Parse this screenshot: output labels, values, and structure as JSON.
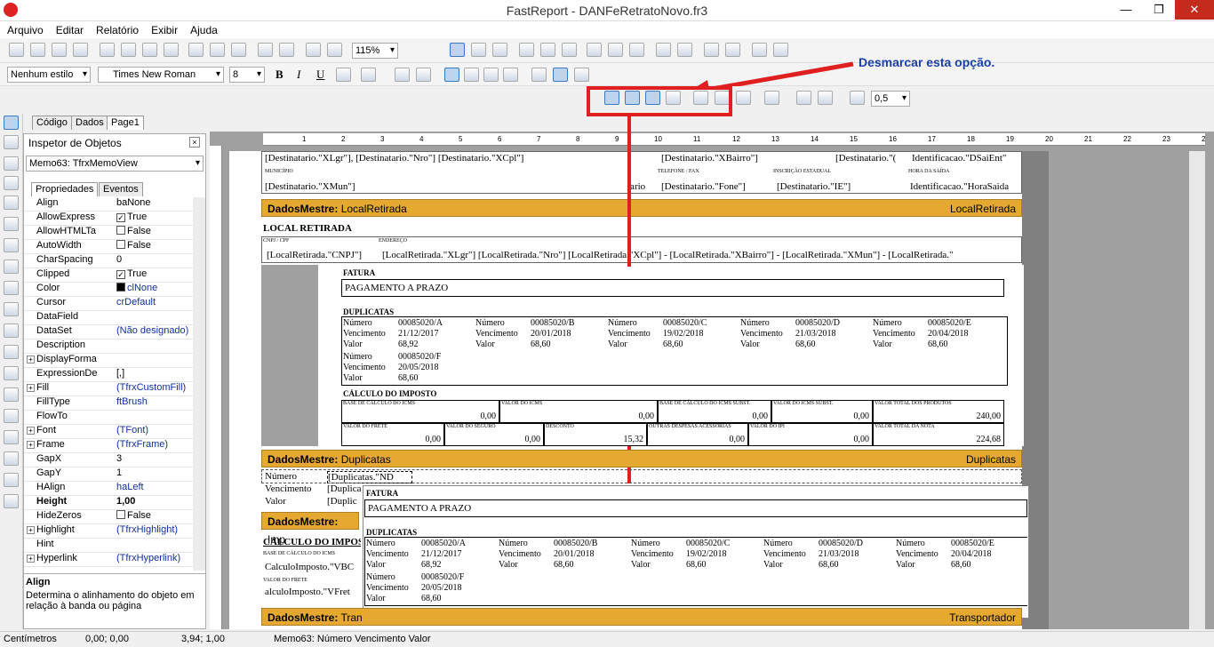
{
  "window": {
    "title": "FastReport - DANFeRetratoNovo.fr3",
    "min": "—",
    "max": "❐",
    "close": "✕"
  },
  "menu": [
    "Arquivo",
    "Editar",
    "Relatório",
    "Exibir",
    "Ajuda"
  ],
  "toolbar": {
    "zoom": "115%",
    "style": "Nenhum estilo",
    "font": "Times New Roman",
    "size": "8",
    "frame_width": "0,5"
  },
  "annotation": "Desmarcar esta opção.",
  "tabs": [
    "Código",
    "Dados",
    "Page1"
  ],
  "inspector": {
    "title": "Inspetor de Objetos",
    "object": "Memo63: TfrxMemoView",
    "tab_props": "Propriedades",
    "tab_events": "Eventos",
    "rows": [
      [
        "Align",
        "baNone"
      ],
      [
        "AllowExpress",
        "True"
      ],
      [
        "AllowHTMLTa",
        "False"
      ],
      [
        "AutoWidth",
        "False"
      ],
      [
        "CharSpacing",
        "0"
      ],
      [
        "Clipped",
        "True"
      ],
      [
        "Color",
        "clNone"
      ],
      [
        "Cursor",
        "crDefault"
      ],
      [
        "DataField",
        ""
      ],
      [
        "DataSet",
        "(Não designado)"
      ],
      [
        "Description",
        ""
      ],
      [
        "DisplayForma",
        ""
      ],
      [
        "ExpressionDe",
        "[,]"
      ],
      [
        "Fill",
        "(TfrxCustomFill)"
      ],
      [
        "FillType",
        "ftBrush"
      ],
      [
        "FlowTo",
        ""
      ],
      [
        "Font",
        "(TFont)"
      ],
      [
        "Frame",
        "(TfrxFrame)"
      ],
      [
        "GapX",
        "3"
      ],
      [
        "GapY",
        "1"
      ],
      [
        "HAlign",
        "haLeft"
      ],
      [
        "Height",
        "1,00"
      ],
      [
        "HideZeros",
        "False"
      ],
      [
        "Highlight",
        "(TfrxHighlight)"
      ],
      [
        "Hint",
        ""
      ],
      [
        "Hyperlink",
        "(TfrxHyperlink)"
      ]
    ],
    "help_title": "Align",
    "help_text": "Determina o alinhamento do objeto em relação à banda ou página"
  },
  "ruler": [
    "1",
    "2",
    "3",
    "4",
    "5",
    "6",
    "7",
    "8",
    "9",
    "10",
    "11",
    "12",
    "13",
    "14",
    "15",
    "16",
    "17",
    "18",
    "19",
    "20",
    "21",
    "22",
    "23",
    "24"
  ],
  "report": {
    "dest1": "[Destinatario.\"XLgr\"], [Destinatario.\"Nro\"]  [Destinatario.\"XCpl\"]",
    "dest2": "[Destinatario.\"XBairro\"]",
    "dest3": "[Destinatario.\"(",
    "dest4": "Identificacao.\"DSaiEnt\"",
    "lbl_mun": "MUNICÍPIO",
    "lbl_tel": "TELEFONE / FAX",
    "lbl_ie": "INSCRIÇÃO ESTADUAL",
    "lbl_hora": "HORA DA SAÍDA",
    "mun": "[Destinatario.\"XMun\"]",
    "uf": "tario",
    "fone": "[Destinatario.\"Fone\"]",
    "ie": "[Destinatario.\"IE\"]",
    "hora": "Identificacao.\"HoraSaida",
    "band1": "DadosMestre:",
    "band1b": "LocalRetirada",
    "band1r": "LocalRetirada",
    "local_title": "LOCAL RETIRADA",
    "lbl_cnpj": "CNPJ / CPF",
    "lbl_end": "ENDEREÇO",
    "cnpj": "[LocalRetirada.\"CNPJ\"]",
    "end": "[LocalRetirada.\"XLgr\"] [LocalRetirada.\"Nro\"] [LocalRetirada.\"XCpl\"] - [LocalRetirada.\"XBairro\"] - [LocalRetirada.\"XMun\"] - [LocalRetirada.\"",
    "fatura": "FATURA",
    "pag": "PAGAMENTO A PRAZO",
    "dup": "DUPLICATAS",
    "duplicatas": [
      [
        "00085020/A",
        "21/12/2017",
        "68,92"
      ],
      [
        "00085020/B",
        "20/01/2018",
        "68,60"
      ],
      [
        "00085020/C",
        "19/02/2018",
        "68,60"
      ],
      [
        "00085020/D",
        "21/03/2018",
        "68,60"
      ],
      [
        "00085020/E",
        "20/04/2018",
        "68,60"
      ],
      [
        "00085020/F",
        "20/05/2018",
        "68,60"
      ]
    ],
    "l_num": "Número",
    "l_venc": "Vencimento",
    "l_val": "Valor",
    "calc": "CÁLCULO DO IMPOSTO",
    "imp1": [
      [
        "BASE DE CÁLCULO DO ICMS",
        "0,00"
      ],
      [
        "VALOR DO ICMS",
        "0,00"
      ],
      [
        "BASE DE CÁLCULO DO ICMS SUBST.",
        "0,00"
      ],
      [
        "VALOR DO ICMS SUBST.",
        "0,00"
      ],
      [
        "VALOR TOTAL DOS PRODUTOS",
        "240,00"
      ]
    ],
    "imp2": [
      [
        "VALOR DO FRETE",
        "0,00"
      ],
      [
        "VALOR DO SEGURO",
        "0,00"
      ],
      [
        "DESCONTO",
        "15,32"
      ],
      [
        "OUTRAS DESPESAS ACESSÓRIAS",
        "0,00"
      ],
      [
        "VALOR DO IPI",
        "0,00"
      ],
      [
        "VALOR TOTAL DA NOTA",
        "224,68"
      ]
    ],
    "band2": "DadosMestre:",
    "band2b": "Duplicatas",
    "band2r": "Duplicatas",
    "dnum": "[Duplicatas.\"ND",
    "dv": "[Duplica",
    "dval": "[Duplic",
    "band3": "DadosMestre:",
    "band3b": "Imp",
    "calc2": "CÁLCULO DO IMPOS",
    "lbl_base2": "BASE DE CÁLCULO DO ICMS",
    "vbc": "CalculoImposto.\"VBC",
    "lbl_frete2": "VALOR DO FRETE",
    "vfret": "alculoImposto.\"VFret",
    "band4": "DadosMestre:",
    "band4b": "Tran",
    "band4r": "Transportador"
  },
  "status": {
    "units": "Centímetros",
    "pos": "0,00; 0,00",
    "size": "3,94; 1,00",
    "obj": "Memo63: Número  Vencimento  Valor"
  }
}
